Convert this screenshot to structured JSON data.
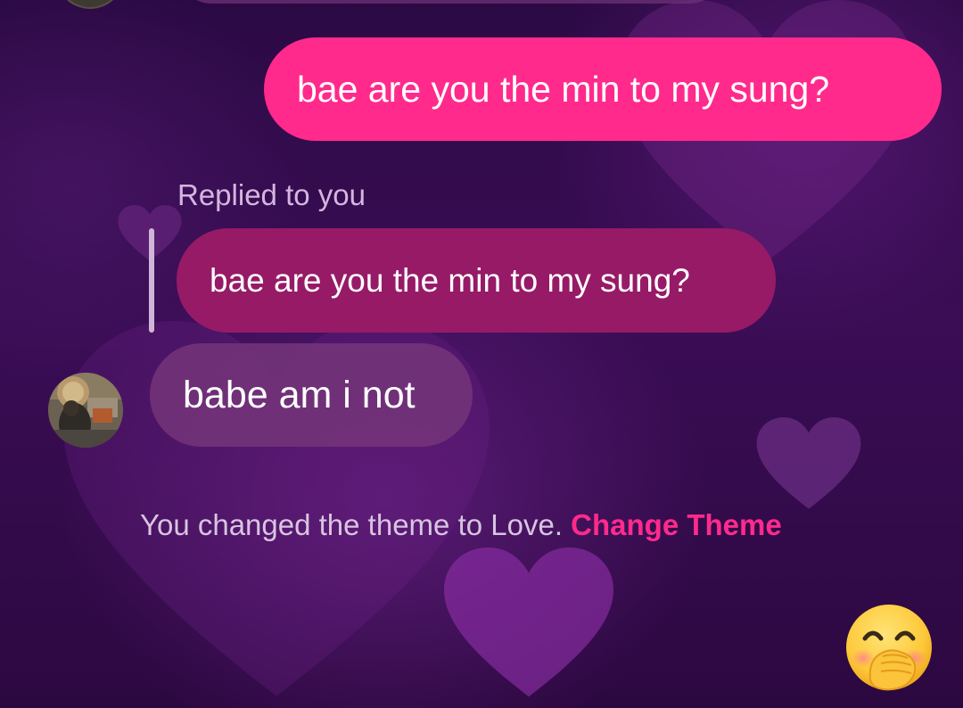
{
  "conversation": {
    "sent_message": "bae are you the min to my sung?",
    "reply": {
      "label": "Replied to you",
      "quoted_text": "bae are you the min to my sung?"
    },
    "received_message": "babe am i not",
    "system_notice": {
      "text": "You changed the theme to Love.",
      "action_label": "Change Theme"
    }
  },
  "theme": {
    "name": "Love",
    "accent_color": "#ff2a8c",
    "quoted_bubble_color": "#971a67",
    "received_bubble_color": "#76367a",
    "background_color": "#2b0a44"
  },
  "icons": {
    "quick_reaction": "hand-over-mouth-emoji-icon",
    "avatar": "contact-avatar"
  }
}
